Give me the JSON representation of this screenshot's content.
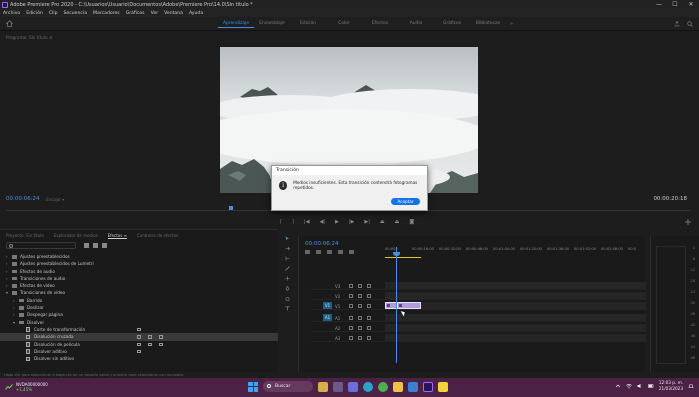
{
  "window": {
    "title": "Adobe Premiere Pro 2020 - C:\\Usuarios\\Usuario\\Documentos\\Adobe\\Premiere Pro\\14.0\\Sin título *",
    "min": "—",
    "max": "☐",
    "close": "✕"
  },
  "menu": [
    "Archivo",
    "Edición",
    "Clip",
    "Secuencia",
    "Marcadores",
    "Gráficos",
    "Ver",
    "Ventana",
    "Ayuda"
  ],
  "workspaces": {
    "tabs": [
      "Aprendizaje",
      "Ensamblaje",
      "Edición",
      "Color",
      "Efectos",
      "Audio",
      "Gráficos",
      "Bibliotecas"
    ],
    "active_index": 0,
    "more": "»"
  },
  "monitor": {
    "label": "Programa: Sin título ≡",
    "timecode_left": "00:00:06:24",
    "fit": "Encajar ▾",
    "timecode_right": "00:00:20:18"
  },
  "dialog": {
    "title": "Transición",
    "message": "Medios insuficientes. Esta transición contendrá fotogramas repetidos.",
    "button": "Aceptar",
    "icon": "i"
  },
  "effects_panel": {
    "tabs": [
      "Proyecto: Sin título",
      "Explorador de medios",
      "Efectos ≡",
      "Controles de efectos"
    ],
    "active_tab": 2,
    "items": [
      {
        "label": "Ajustes preestablecidos",
        "level": 0,
        "type": "folder"
      },
      {
        "label": "Ajustes preestablecidos de Lumetri",
        "level": 0,
        "type": "folder"
      },
      {
        "label": "Efectos de audio",
        "level": 0,
        "type": "folder"
      },
      {
        "label": "Transiciones de audio",
        "level": 0,
        "type": "folder"
      },
      {
        "label": "Efectos de vídeo",
        "level": 0,
        "type": "folder"
      },
      {
        "label": "Transiciones de vídeo",
        "level": 0,
        "type": "folder",
        "open": true
      },
      {
        "label": "Barrido",
        "level": 1,
        "type": "folder"
      },
      {
        "label": "Deslizar",
        "level": 1,
        "type": "folder"
      },
      {
        "label": "Despegar página",
        "level": 1,
        "type": "folder"
      },
      {
        "label": "Disolver",
        "level": 1,
        "type": "folder",
        "open": true
      },
      {
        "label": "Corte de transformación",
        "level": 2,
        "type": "file",
        "badges": 1
      },
      {
        "label": "Disolución cruzada",
        "level": 2,
        "type": "file",
        "badges": 3,
        "selected": true
      },
      {
        "label": "Disolución de película",
        "level": 2,
        "type": "file",
        "badges": 3
      },
      {
        "label": "Disolver aditivo",
        "level": 2,
        "type": "file",
        "badges": 1
      },
      {
        "label": "Disolver sin aditivo",
        "level": 2,
        "type": "file",
        "badges": 0
      }
    ]
  },
  "timeline": {
    "timecode": "00:00:06:24",
    "ruler": [
      "00:00",
      "00:00:16:00",
      "00:00:32:00",
      "00:00:48:00",
      "00:01:04:00",
      "00:01:20:00",
      "00:01:36:00",
      "00:01:52:00",
      "00:02:08:00",
      "00:0"
    ],
    "tracks": [
      {
        "name": "V3",
        "src": ""
      },
      {
        "name": "V2",
        "src": ""
      },
      {
        "name": "V1",
        "src": "V1"
      },
      {
        "name": "A1",
        "src": "A1"
      },
      {
        "name": "A2",
        "src": ""
      },
      {
        "name": "A3",
        "src": ""
      }
    ]
  },
  "meter": {
    "scale": [
      "0",
      "-6",
      "-12",
      "-18",
      "-24",
      "-30",
      "-36",
      "-42",
      "-48",
      "-54",
      "dB"
    ]
  },
  "status": "Haga clic para seleccionar o haga clic en un espacio vacío y arrastre para seleccionar con recuadro.",
  "taskbar": {
    "weather_title": "NVDA00000000",
    "weather_sub": "+1,45%",
    "search": "Buscar",
    "time": "12:03 p. m.",
    "date": "21/03/2023"
  },
  "colors": {
    "accent": "#3f8fe6",
    "clip": "#b19cd9",
    "taskbar": "#4b2145",
    "dialog_button": "#1473e6"
  }
}
